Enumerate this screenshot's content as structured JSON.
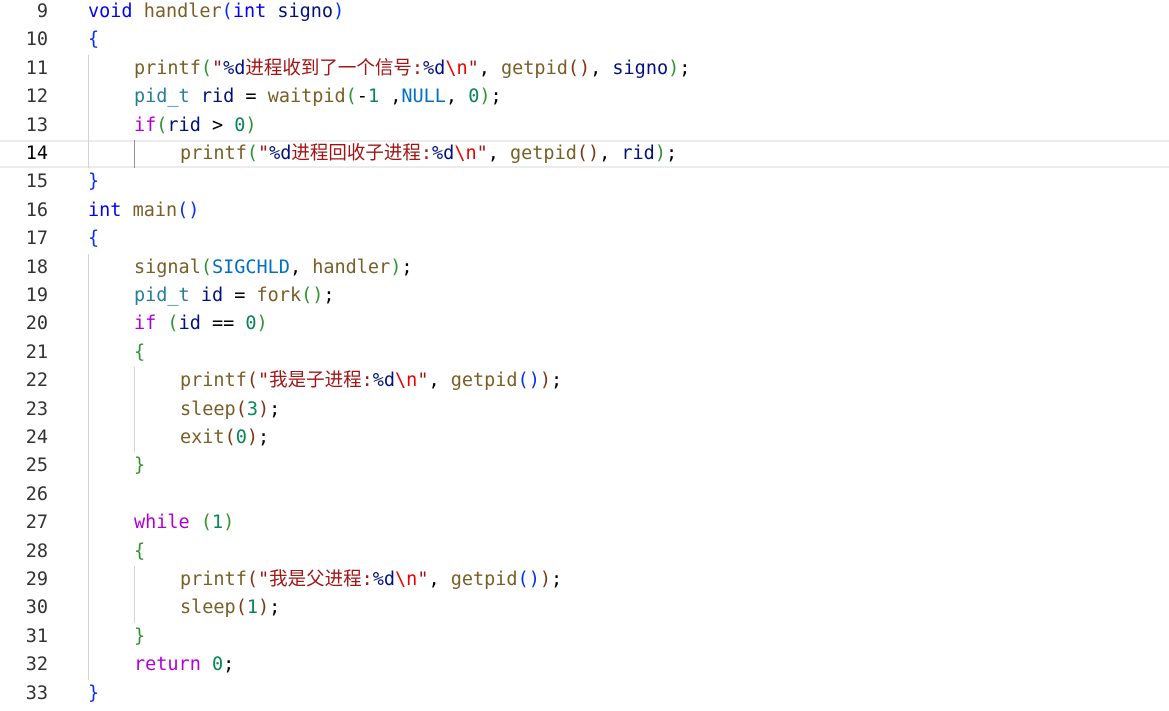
{
  "editor": {
    "language": "c",
    "current_line": 14,
    "lines": [
      {
        "n": "9",
        "indent": 0,
        "tokens": [
          [
            "kw",
            "void"
          ],
          [
            "",
            " "
          ],
          [
            "fn",
            "handler"
          ],
          [
            "b1",
            "("
          ],
          [
            "kw",
            "int"
          ],
          [
            "",
            " "
          ],
          [
            "var",
            "signo"
          ],
          [
            "b1",
            ")"
          ]
        ]
      },
      {
        "n": "10",
        "indent": 0,
        "tokens": [
          [
            "b1",
            "{"
          ]
        ]
      },
      {
        "n": "11",
        "indent": 1,
        "tokens": [
          [
            "fn",
            "printf"
          ],
          [
            "b2",
            "("
          ],
          [
            "str",
            "\""
          ],
          [
            "fmt",
            "%d"
          ],
          [
            "str",
            "进程收到了一个信号:"
          ],
          [
            "fmt",
            "%d"
          ],
          [
            "esc",
            "\\n"
          ],
          [
            "str",
            "\""
          ],
          [
            "",
            ", "
          ],
          [
            "fn",
            "getpid"
          ],
          [
            "b3",
            "()"
          ],
          [
            "",
            ", "
          ],
          [
            "var",
            "signo"
          ],
          [
            "b2",
            ")"
          ],
          [
            "",
            ";"
          ]
        ]
      },
      {
        "n": "12",
        "indent": 1,
        "tokens": [
          [
            "ty",
            "pid_t"
          ],
          [
            "",
            " "
          ],
          [
            "var",
            "rid"
          ],
          [
            "",
            " = "
          ],
          [
            "fn",
            "waitpid"
          ],
          [
            "b2",
            "("
          ],
          [
            "",
            "-"
          ],
          [
            "num",
            "1"
          ],
          [
            "",
            " ,"
          ],
          [
            "const",
            "NULL"
          ],
          [
            "",
            ", "
          ],
          [
            "num",
            "0"
          ],
          [
            "b2",
            ")"
          ],
          [
            "",
            ";"
          ]
        ]
      },
      {
        "n": "13",
        "indent": 1,
        "tokens": [
          [
            "kw2",
            "if"
          ],
          [
            "b2",
            "("
          ],
          [
            "var",
            "rid"
          ],
          [
            "",
            " > "
          ],
          [
            "num",
            "0"
          ],
          [
            "b2",
            ")"
          ]
        ]
      },
      {
        "n": "14",
        "indent": 2,
        "tokens": [
          [
            "fn",
            "printf"
          ],
          [
            "b2",
            "("
          ],
          [
            "str",
            "\""
          ],
          [
            "fmt",
            "%d"
          ],
          [
            "str",
            "进程回收子进程:"
          ],
          [
            "fmt",
            "%d"
          ],
          [
            "esc",
            "\\n"
          ],
          [
            "str",
            "\""
          ],
          [
            "",
            ", "
          ],
          [
            "fn",
            "getpid"
          ],
          [
            "b3",
            "()"
          ],
          [
            "",
            ", "
          ],
          [
            "var",
            "rid"
          ],
          [
            "b2",
            ")"
          ],
          [
            "",
            ";"
          ]
        ]
      },
      {
        "n": "15",
        "indent": 0,
        "tokens": [
          [
            "b1",
            "}"
          ]
        ]
      },
      {
        "n": "16",
        "indent": 0,
        "tokens": [
          [
            "kw",
            "int"
          ],
          [
            "",
            " "
          ],
          [
            "fn",
            "main"
          ],
          [
            "b1",
            "()"
          ]
        ]
      },
      {
        "n": "17",
        "indent": 0,
        "tokens": [
          [
            "b1",
            "{"
          ]
        ]
      },
      {
        "n": "18",
        "indent": 1,
        "tokens": [
          [
            "fn",
            "signal"
          ],
          [
            "b2",
            "("
          ],
          [
            "const",
            "SIGCHLD"
          ],
          [
            "",
            ", "
          ],
          [
            "fn",
            "handler"
          ],
          [
            "b2",
            ")"
          ],
          [
            "",
            ";"
          ]
        ]
      },
      {
        "n": "19",
        "indent": 1,
        "tokens": [
          [
            "ty",
            "pid_t"
          ],
          [
            "",
            " "
          ],
          [
            "var",
            "id"
          ],
          [
            "",
            " = "
          ],
          [
            "fn",
            "fork"
          ],
          [
            "b2",
            "()"
          ],
          [
            "",
            ";"
          ]
        ]
      },
      {
        "n": "20",
        "indent": 1,
        "tokens": [
          [
            "kw2",
            "if"
          ],
          [
            "",
            " "
          ],
          [
            "b2",
            "("
          ],
          [
            "var",
            "id"
          ],
          [
            "",
            " == "
          ],
          [
            "num",
            "0"
          ],
          [
            "b2",
            ")"
          ]
        ]
      },
      {
        "n": "21",
        "indent": 1,
        "tokens": [
          [
            "b2",
            "{"
          ]
        ]
      },
      {
        "n": "22",
        "indent": 2,
        "tokens": [
          [
            "fn",
            "printf"
          ],
          [
            "b3",
            "("
          ],
          [
            "str",
            "\"我是子进程:"
          ],
          [
            "fmt",
            "%d"
          ],
          [
            "esc",
            "\\n"
          ],
          [
            "str",
            "\""
          ],
          [
            "",
            ", "
          ],
          [
            "fn",
            "getpid"
          ],
          [
            "b1",
            "()"
          ],
          [
            "b3",
            ")"
          ],
          [
            "",
            ";"
          ]
        ]
      },
      {
        "n": "23",
        "indent": 2,
        "tokens": [
          [
            "fn",
            "sleep"
          ],
          [
            "b3",
            "("
          ],
          [
            "num",
            "3"
          ],
          [
            "b3",
            ")"
          ],
          [
            "",
            ";"
          ]
        ]
      },
      {
        "n": "24",
        "indent": 2,
        "tokens": [
          [
            "fn",
            "exit"
          ],
          [
            "b3",
            "("
          ],
          [
            "num",
            "0"
          ],
          [
            "b3",
            ")"
          ],
          [
            "",
            ";"
          ]
        ]
      },
      {
        "n": "25",
        "indent": 1,
        "tokens": [
          [
            "b2",
            "}"
          ]
        ]
      },
      {
        "n": "26",
        "indent": 0,
        "tokens": []
      },
      {
        "n": "27",
        "indent": 1,
        "tokens": [
          [
            "kw2",
            "while"
          ],
          [
            "",
            " "
          ],
          [
            "b2",
            "("
          ],
          [
            "num",
            "1"
          ],
          [
            "b2",
            ")"
          ]
        ]
      },
      {
        "n": "28",
        "indent": 1,
        "tokens": [
          [
            "b2",
            "{"
          ]
        ]
      },
      {
        "n": "29",
        "indent": 2,
        "tokens": [
          [
            "fn",
            "printf"
          ],
          [
            "b3",
            "("
          ],
          [
            "str",
            "\"我是父进程:"
          ],
          [
            "fmt",
            "%d"
          ],
          [
            "esc",
            "\\n"
          ],
          [
            "str",
            "\""
          ],
          [
            "",
            ", "
          ],
          [
            "fn",
            "getpid"
          ],
          [
            "b1",
            "()"
          ],
          [
            "b3",
            ")"
          ],
          [
            "",
            ";"
          ]
        ]
      },
      {
        "n": "30",
        "indent": 2,
        "tokens": [
          [
            "fn",
            "sleep"
          ],
          [
            "b3",
            "("
          ],
          [
            "num",
            "1"
          ],
          [
            "b3",
            ")"
          ],
          [
            "",
            ";"
          ]
        ]
      },
      {
        "n": "31",
        "indent": 1,
        "tokens": [
          [
            "b2",
            "}"
          ]
        ]
      },
      {
        "n": "32",
        "indent": 1,
        "tokens": [
          [
            "kw2",
            "return"
          ],
          [
            "",
            " "
          ],
          [
            "num",
            "0"
          ],
          [
            "",
            ";"
          ]
        ]
      },
      {
        "n": "33",
        "indent": 0,
        "tokens": [
          [
            "b1",
            "}"
          ]
        ]
      }
    ]
  }
}
